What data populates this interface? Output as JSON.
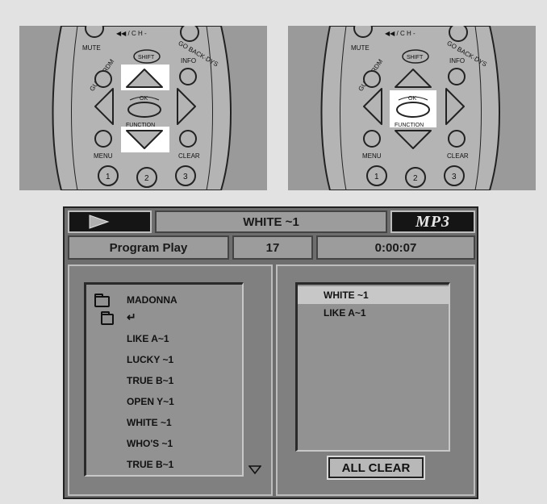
{
  "remote_left": {
    "labels": {
      "mute": "MUTE",
      "ch": "◀◀ / C H -",
      "goback": "GO BACK·DYS",
      "guide": "GUIDE·RDM",
      "shift": "SHIFT",
      "info": "INFO",
      "ok": "OK",
      "function": "FUNCTION",
      "menu": "MENU",
      "clear": "CLEAR",
      "n1": "1",
      "n2": "2",
      "n3": "3"
    },
    "highlight": "up-down"
  },
  "remote_right": {
    "labels": {
      "mute": "MUTE",
      "ch": "◀◀ / C H -",
      "goback": "GO BACK·DYS",
      "guide": "GUIDE·RDM",
      "shift": "SHIFT",
      "info": "INFO",
      "ok": "OK",
      "function": "FUNCTION",
      "menu": "MENU",
      "clear": "CLEAR",
      "n1": "1",
      "n2": "2",
      "n3": "3"
    },
    "highlight": "ok"
  },
  "player": {
    "track_title": "WHITE ~1",
    "format_logo": "MP3",
    "mode": "Program Play",
    "track_number": "17",
    "time": "0:00:07"
  },
  "browser": {
    "folder": "MADONNA",
    "parent_symbol": "↵",
    "files": [
      "LIKE A~1",
      "LUCKY ~1",
      "TRUE B~1",
      "OPEN Y~1",
      "WHITE ~1",
      "WHO'S ~1",
      "TRUE B~1"
    ]
  },
  "program": {
    "items": [
      "WHITE ~1",
      "LIKE A~1"
    ],
    "selected_index": 0,
    "clear_label": "ALL CLEAR"
  },
  "colors": {
    "highlight": "#ffffff",
    "screen_bg": "#6e6e6e",
    "selection": "#c7c7c7"
  }
}
